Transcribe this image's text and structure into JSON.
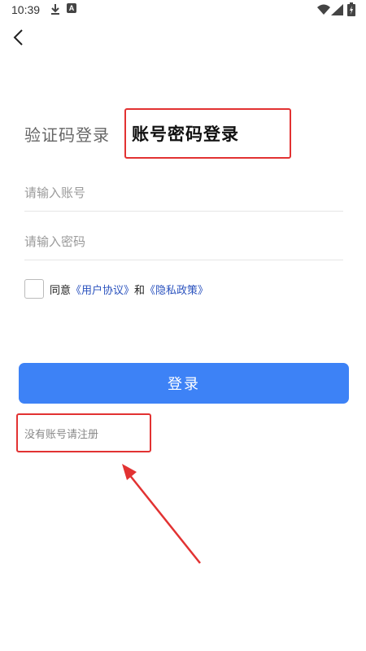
{
  "status_bar": {
    "time": "10:39",
    "icons": [
      "download-icon",
      "a-icon",
      "wifi-icon",
      "signal-icon",
      "battery-icon"
    ],
    "a_label": "A"
  },
  "nav": {
    "back_icon": "chevron-left-icon"
  },
  "tabs": {
    "sms_label": "验证码登录",
    "password_label": "账号密码登录",
    "active": "password"
  },
  "form": {
    "account_placeholder": "请输入账号",
    "account_value": "",
    "password_placeholder": "请输入密码",
    "password_value": ""
  },
  "agreement": {
    "checked": false,
    "prefix": "同意",
    "user_agreement": "《用户协议》",
    "conjunction": "和",
    "privacy_policy": "《隐私政策》"
  },
  "login_button": {
    "label": "登录"
  },
  "register": {
    "label": "没有账号请注册"
  },
  "colors": {
    "primary": "#3d82f6",
    "link": "#2a52be",
    "annotation": "#e23232"
  }
}
